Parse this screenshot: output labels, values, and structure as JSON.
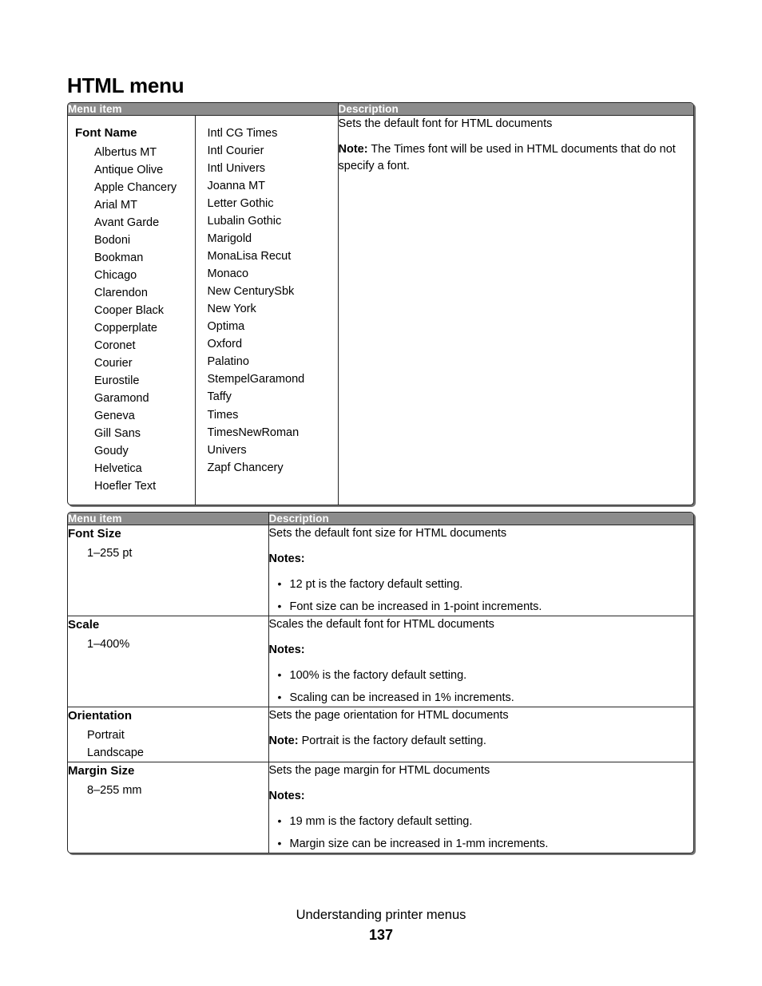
{
  "page": {
    "title": "HTML menu",
    "footer_title": "Understanding printer menus",
    "page_number": "137"
  },
  "table_font_name": {
    "headers": {
      "menu_item": "Menu item",
      "description": "Description"
    },
    "item_label": "Font Name",
    "fonts_column_1": [
      "Albertus MT",
      "Antique Olive",
      "Apple Chancery",
      "Arial MT",
      "Avant Garde",
      "Bodoni",
      "Bookman",
      "Chicago",
      "Clarendon",
      "Cooper Black",
      "Copperplate",
      "Coronet",
      "Courier",
      "Eurostile",
      "Garamond",
      "Geneva",
      "Gill Sans",
      "Goudy",
      "Helvetica",
      "Hoefler Text"
    ],
    "fonts_column_2": [
      "Intl CG Times",
      "Intl Courier",
      "Intl Univers",
      "Joanna MT",
      "Letter Gothic",
      "Lubalin Gothic",
      "Marigold",
      "MonaLisa Recut",
      "Monaco",
      "New CenturySbk",
      "New York",
      "Optima",
      "Oxford",
      "Palatino",
      "StempelGaramond",
      "Taffy",
      "Times",
      "TimesNewRoman",
      "Univers",
      "Zapf Chancery"
    ],
    "description": {
      "line1": "Sets the default font for HTML documents",
      "note_label": "Note:",
      "note_text": " The Times font will be used in HTML documents that do not specify a font."
    }
  },
  "table_html_props": {
    "headers": {
      "menu_item": "Menu item",
      "description": "Description"
    },
    "notes_label": "Notes:",
    "rows": [
      {
        "item": "Font Size",
        "options": [
          "1–255 pt"
        ],
        "desc": "Sets the default font size for HTML documents",
        "notes": [
          "12 pt is the factory default setting.",
          "Font size can be increased in 1-point increments."
        ]
      },
      {
        "item": "Scale",
        "options": [
          "1–400%"
        ],
        "desc": "Scales the default font for HTML documents",
        "notes": [
          "100% is the factory default setting.",
          "Scaling can be increased in 1% increments."
        ]
      },
      {
        "item": "Orientation",
        "options": [
          "Portrait",
          "Landscape"
        ],
        "desc": "Sets the page orientation for HTML documents",
        "note_label": "Note:",
        "note_text": " Portrait is the factory default setting.",
        "notes": []
      },
      {
        "item": "Margin Size",
        "options": [
          "8–255 mm"
        ],
        "desc": "Sets the page margin for HTML documents",
        "notes": [
          "19 mm is the factory default setting.",
          "Margin size can be increased in 1-mm increments."
        ]
      }
    ]
  },
  "colors": {
    "header_gray": "#8c8c8c",
    "border": "#262626",
    "text": "#000000"
  }
}
